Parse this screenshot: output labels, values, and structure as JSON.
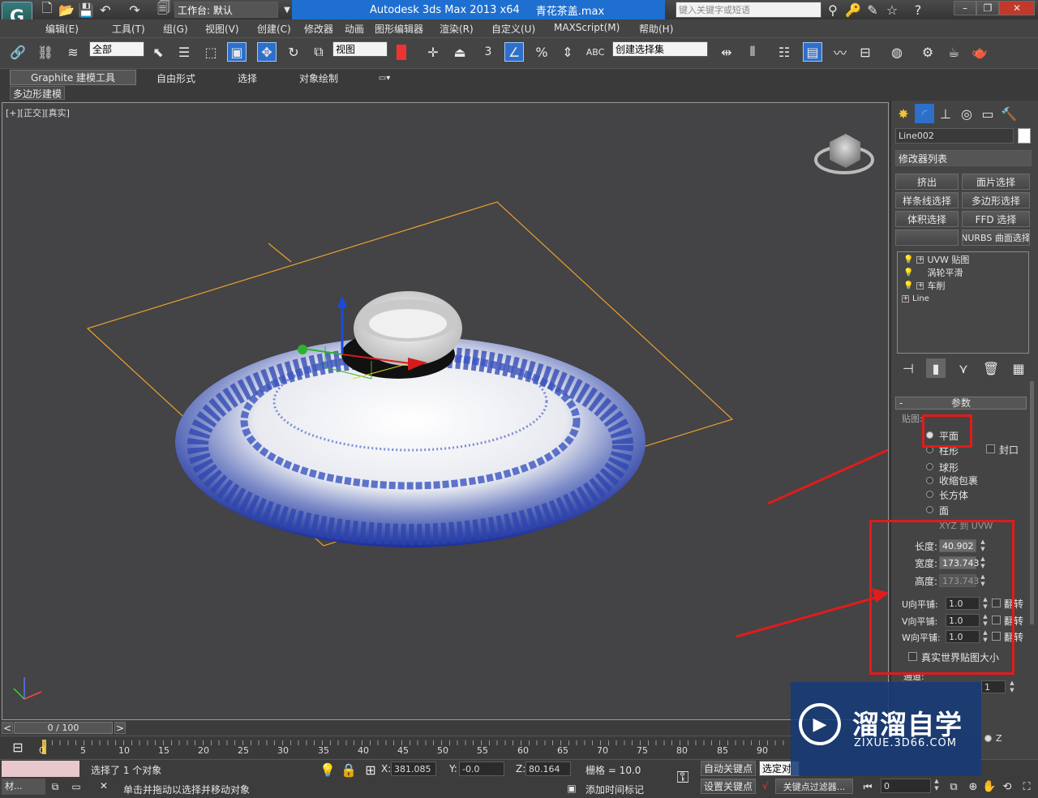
{
  "app": {
    "logo": "G",
    "title": "Autodesk 3ds Max  2013 x64",
    "file": "青花茶盖.max",
    "workspace": "工作台: 默认",
    "search_placeholder": "键入关键字或短语"
  },
  "menu": [
    "编辑(E)",
    "工具(T)",
    "组(G)",
    "视图(V)",
    "创建(C)",
    "修改器",
    "动画",
    "图形编辑器",
    "渲染(R)",
    "自定义(U)",
    "MAXScript(M)",
    "帮助(H)"
  ],
  "toolbar": {
    "selection_filter": "全部",
    "ref_coord": "视图",
    "snap_value": "3",
    "named_selection": "创建选择集"
  },
  "ribbon": {
    "tabs": [
      "Graphite 建模工具",
      "自由形式",
      "选择",
      "对象绘制"
    ],
    "sub": "多边形建模"
  },
  "viewport": {
    "label": "[+][正交][真实]"
  },
  "panel": {
    "object_name": "Line002",
    "modifier_list": "修改器列表",
    "buttons": [
      "挤出",
      "面片选择",
      "样条线选择",
      "多边形选择",
      "体积选择",
      "FFD 选择",
      "",
      "NURBS 曲面选择"
    ],
    "stack": [
      "UVW 贴图",
      "涡轮平滑",
      "车削",
      "Line"
    ],
    "params_title": "参数",
    "mapping_label": "贴图:",
    "mapping": [
      "平面",
      "柱形",
      "球形",
      "收缩包裹",
      "长方体",
      "面",
      "XYZ 到 UVW"
    ],
    "cap": "封口",
    "length_label": "长度:",
    "length": "40.902",
    "width_label": "宽度:",
    "width": "173.743",
    "height_label": "高度:",
    "height": "173.743",
    "u_tile_label": "U向平铺:",
    "u_tile": "1.0",
    "v_tile_label": "V向平铺:",
    "v_tile": "1.0",
    "w_tile_label": "W向平铺:",
    "w_tile": "1.0",
    "flip": "翻转",
    "realworld": "真实世界贴图大小",
    "channel_label": "通道:",
    "channel": "1"
  },
  "timeline": {
    "frame": "0 / 100",
    "ticks": [
      "0",
      "5",
      "10",
      "15",
      "20",
      "25",
      "30",
      "35",
      "40",
      "45",
      "50",
      "55",
      "60",
      "65",
      "70",
      "75",
      "80",
      "85",
      "90"
    ]
  },
  "status": {
    "selected": "选择了 1 个对象",
    "hint": "单击并拖动以选择并移动对象",
    "x_label": "X:",
    "x": "381.085",
    "y_label": "Y:",
    "y": "-0.0",
    "z_label": "Z:",
    "z": "80.164",
    "grid": "栅格 = 10.0",
    "auto_key": "自动关键点",
    "set_key": "设置关键点",
    "selected_mode": "选定对",
    "key_filter": "关键点过滤器...",
    "add_time_tag": "添加时间标记",
    "time_value": "0",
    "taskbar": "材..."
  },
  "watermark": {
    "title": "溜溜自学",
    "url": "ZIXUE.3D66.COM"
  }
}
